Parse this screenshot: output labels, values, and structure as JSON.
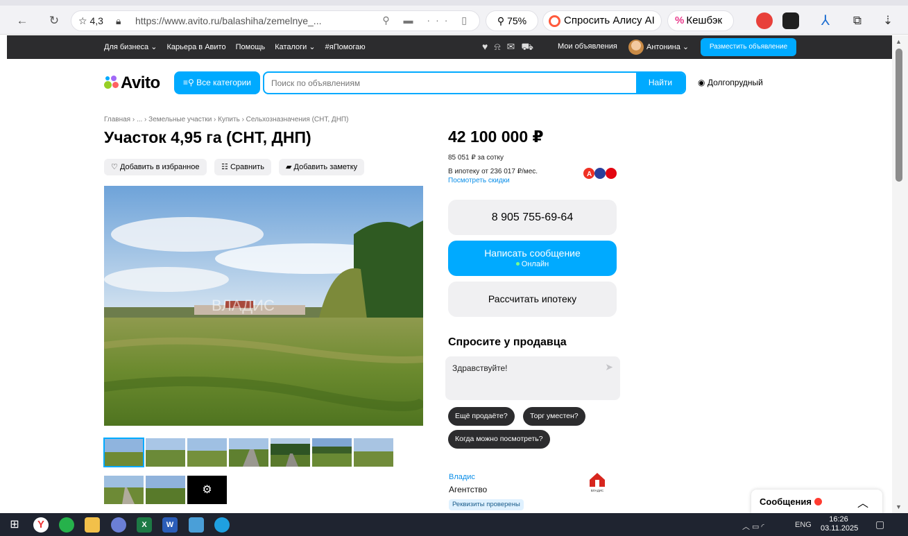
{
  "browser": {
    "rating": "☆ 4,3",
    "url_host": "https://www.avito.ru",
    "url_path": "/balashiha/zemelnye_...",
    "zoom": "75%",
    "alice_label": "Спросить Алису AI",
    "cashback_label": "Кешбэк"
  },
  "topbar": {
    "links": [
      "Для бизнеса ⌄",
      "Карьера в Авито",
      "Помощь",
      "Каталоги ⌄",
      "#яПомогаю"
    ],
    "my_ads": "Мои объявления",
    "user_name": "Антонина ⌄",
    "post_button": "Разместить объявление"
  },
  "header": {
    "logo_text": "Avito",
    "categories_button": "Все категории",
    "search_placeholder": "Поиск по объявлениям",
    "search_button": "Найти",
    "location": "Долгопрудный"
  },
  "listing": {
    "breadcrumbs": "Главная › ... › Земельные участки › Купить › Сельхозназначения (СНТ, ДНП)",
    "title": "Участок 4,95 га (СНТ, ДНП)",
    "actions": {
      "favorite": "Добавить в избранное",
      "compare": "Сравнить",
      "note": "Добавить заметку"
    },
    "watermark": "ВЛАДИС"
  },
  "sidebar": {
    "price": "42 100 000 ₽",
    "price_per_sotka": "85 051 ₽ за сотку",
    "mortgage_line": "В ипотеку от 236 017 ₽/мес.",
    "discounts_link": "Посмотреть скидки",
    "phone": "8 905 755-69-64",
    "message_button": "Написать сообщение",
    "online_status": "Онлайн",
    "mortgage_button": "Рассчитать ипотеку",
    "ask_title": "Спросите у продавца",
    "ask_text": "Здравствуйте!",
    "chips": [
      "Ещё продаёте?",
      "Торг уместен?",
      "Когда можно посмотреть?"
    ],
    "seller_name": "Владис",
    "seller_type": "Агентство",
    "verified_badge": "Реквизиты проверены",
    "seller_logo_caption": "ВЛАДИС"
  },
  "messenger": {
    "label": "Сообщения"
  },
  "taskbar": {
    "lang": "ENG",
    "time": "16:26",
    "date": "03.11.2025"
  },
  "colors": {
    "accent": "#00aaff",
    "dark_bar": "#2c2c2e",
    "link": "#0a8ee8"
  }
}
